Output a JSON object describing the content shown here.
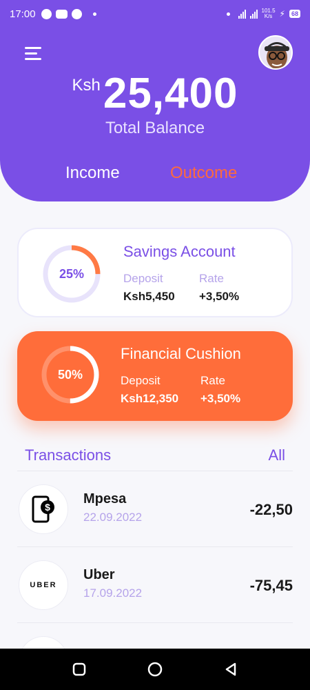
{
  "status_bar": {
    "time": "17:00",
    "net_speed_value": "101.5",
    "net_speed_unit": "K/s",
    "battery": "68"
  },
  "header": {
    "currency": "Ksh",
    "balance": "25,400",
    "balance_label": "Total Balance",
    "tabs": [
      "Income",
      "Outcome"
    ]
  },
  "cards": [
    {
      "title": "Savings Account",
      "percent_label": "25%",
      "progress": 0.25,
      "deposit_label": "Deposit",
      "deposit": "Ksh5,450",
      "rate_label": "Rate",
      "rate": "+3,50%"
    },
    {
      "title": "Financial Cushion",
      "percent_label": "50%",
      "progress": 0.5,
      "deposit_label": "Deposit",
      "deposit": "Ksh12,350",
      "rate_label": "Rate",
      "rate": "+3,50%"
    }
  ],
  "transactions": {
    "title": "Transactions",
    "all_label": "All",
    "items": [
      {
        "name": "Mpesa",
        "date": "22.09.2022",
        "amount": "-22,50",
        "icon": "mobile-money-icon"
      },
      {
        "name": "Uber",
        "date": "17.09.2022",
        "amount": "-75,45",
        "logo_text": "UBER"
      }
    ]
  },
  "colors": {
    "primary": "#7a4fe6",
    "accent": "#ff6d3a",
    "muted_purple": "#b5a3ea"
  }
}
